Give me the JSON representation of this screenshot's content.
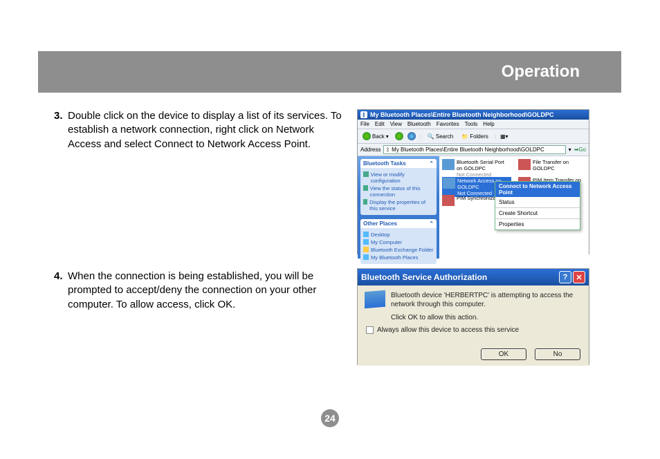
{
  "header": {
    "title": "Operation"
  },
  "steps": {
    "s3": {
      "num": "3.",
      "text": "Double click on the device to display a list of its services. To establish a network connection, right click on Network Access and select Connect to Network Access Point."
    },
    "s4": {
      "num": "4.",
      "text": "When the connection is being established, you will be prompted to accept/deny the connection on your other computer. To allow access, click OK."
    }
  },
  "shot1": {
    "title": "My Bluetooth Places\\Entire Bluetooth Neighborhood\\GOLDPC",
    "menus": [
      "File",
      "Edit",
      "View",
      "Bluetooth",
      "Favorites",
      "Tools",
      "Help"
    ],
    "toolbar": {
      "back": "Back",
      "search": "Search",
      "folders": "Folders"
    },
    "address_label": "Address",
    "address_value": "My Bluetooth Places\\Entire Bluetooth Neighborhood\\GOLDPC",
    "go": "Go",
    "tasks": {
      "heading": "Bluetooth Tasks",
      "items": [
        "View or modify configuration",
        "View the status of this connection",
        "Display the properties of this service"
      ]
    },
    "other": {
      "heading": "Other Places",
      "items": [
        "Desktop",
        "My Computer",
        "Bluetooth Exchange Folder",
        "My Bluetooth Places"
      ]
    },
    "services": {
      "serial": {
        "label": "Bluetooth Serial Port on GOLDPC",
        "status": "Not Connected"
      },
      "file": {
        "label": "File Transfer on GOLDPC"
      },
      "net": {
        "label": "Network Access on GOLDPC",
        "status": "Not Connected"
      },
      "pim_item": {
        "label": "PIM Item Transfer on GOLDPC"
      },
      "pim_sync": {
        "label": "PIM Synchronization o"
      }
    },
    "context_menu": {
      "highlighted": "Connect to Network Access Point",
      "items": [
        "Status",
        "Create Shortcut",
        "Properties"
      ]
    }
  },
  "shot2": {
    "title": "Bluetooth Service Authorization",
    "msg1": "Bluetooth device 'HERBERTPC' is attempting to access the network through this computer.",
    "msg2": "Click OK to allow this action.",
    "checkbox": "Always allow this device to access this service",
    "ok": "OK",
    "no": "No"
  },
  "page_number": "24"
}
